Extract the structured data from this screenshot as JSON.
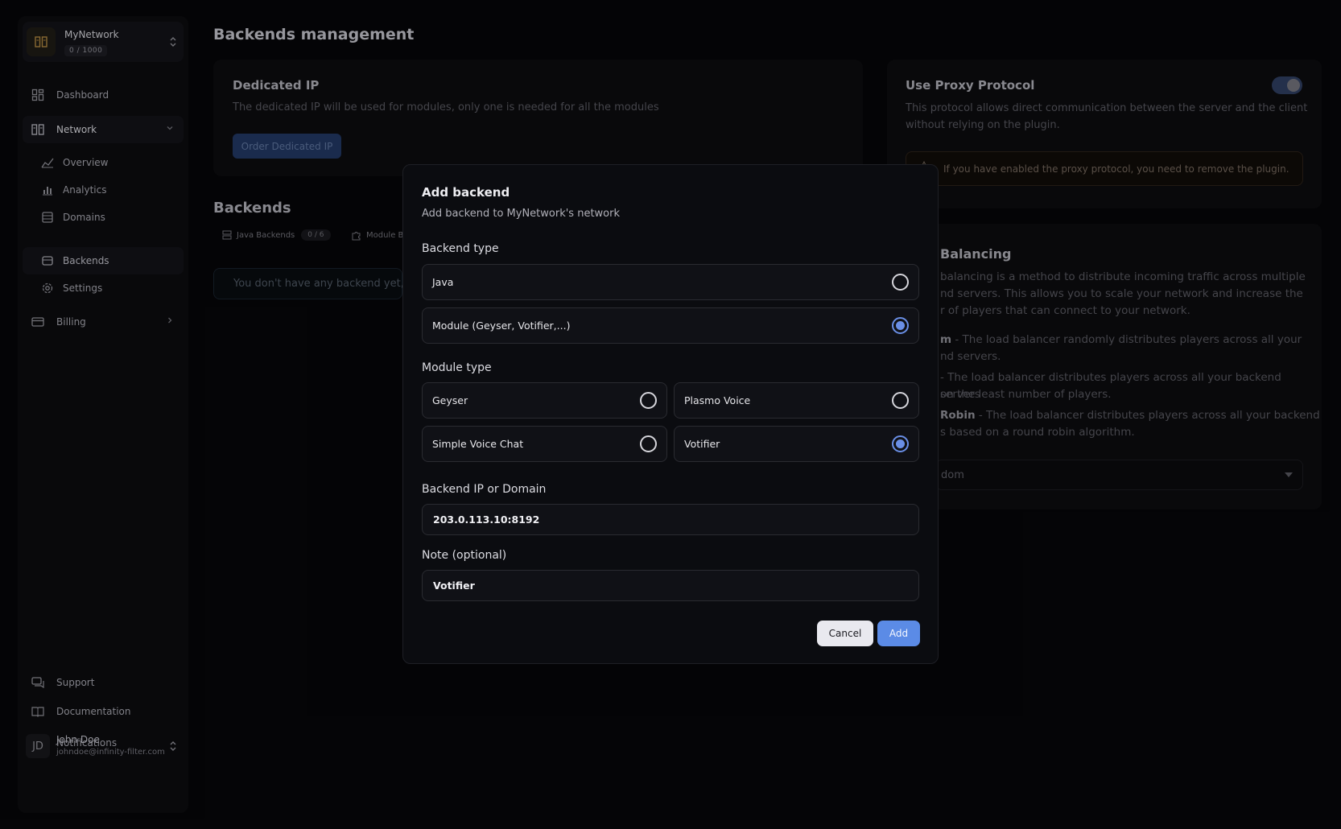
{
  "sidebar": {
    "org_name": "MyNetwork",
    "org_quota": "0 / 1000",
    "nav": {
      "dashboard": "Dashboard",
      "network": "Network",
      "overview": "Overview",
      "analytics": "Analytics",
      "domains": "Domains",
      "backends": "Backends",
      "settings": "Settings",
      "billing": "Billing",
      "support": "Support",
      "documentation": "Documentation",
      "notifications": "Notifications"
    },
    "user": {
      "initials": "JD",
      "name": "John Doe",
      "email": "johndoe@infinity-filter.com"
    }
  },
  "main": {
    "title": "Backends management",
    "dedicated_ip": {
      "title": "Dedicated IP",
      "text": "The dedicated IP will be used for modules, only one is needed for all the modules",
      "button": "Order Dedicated IP"
    },
    "backends": {
      "title": "Backends",
      "tab_java": "Java Backends",
      "tab_java_count": "0 / 6",
      "tab_module": "Module Ba",
      "empty_text": "You don't have any backend yet, "
    },
    "proxy": {
      "title": "Use Proxy Protocol",
      "text1": "This protocol allows direct communication between the server and the client",
      "text2": "without relying on the plugin.",
      "warning": "If you have enabled the proxy protocol, you need to remove the plugin."
    },
    "load_balancing": {
      "title": "Balancing",
      "intro1": "balancing is a method to distribute incoming traffic across multiple",
      "intro2": "nd servers. This allows you to scale your network and increase the",
      "intro3": "r of players that can connect to your network.",
      "random_name": "m",
      "random1": " - The load balancer randomly distributes players across all your",
      "random2": "nd servers.",
      "least1": "- The load balancer distributes players across all your backend servers",
      "least2": "on the least number of players.",
      "rr_name": "Robin",
      "rr1": " - The load balancer distributes players across all your backend",
      "rr2": "s based on a round robin algorithm.",
      "select_value": "dom"
    }
  },
  "modal": {
    "title": "Add backend",
    "subtitle": "Add backend to MyNetwork's network",
    "backend_type_label": "Backend type",
    "backend_types": [
      {
        "label": "Java",
        "selected": false
      },
      {
        "label": "Module (Geyser, Votifier,...)",
        "selected": true
      }
    ],
    "module_type_label": "Module type",
    "module_types": [
      {
        "label": "Geyser",
        "selected": false
      },
      {
        "label": "Plasmo Voice",
        "selected": false
      },
      {
        "label": "Simple Voice Chat",
        "selected": false
      },
      {
        "label": "Votifier",
        "selected": true
      }
    ],
    "ip_label": "Backend IP or Domain",
    "ip_value": "203.0.113.10:8192",
    "note_label": "Note (optional)",
    "note_value": "Votifier",
    "cancel": "Cancel",
    "add": "Add"
  },
  "colors": {
    "accent": "#5b8be6",
    "background": "#060608",
    "card": "#0b0b0e"
  }
}
